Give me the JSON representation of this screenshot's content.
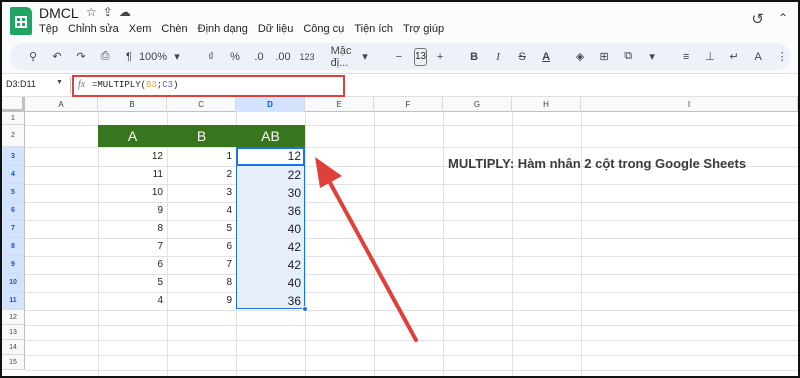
{
  "app": {
    "doc_title": "DMCL",
    "menu": [
      "Tệp",
      "Chỉnh sửa",
      "Xem",
      "Chèn",
      "Định dạng",
      "Dữ liệu",
      "Công cụ",
      "Tiện ích",
      "Trợ giúp"
    ]
  },
  "toolbar": {
    "zoom": "100%",
    "currency": "₫",
    "percent": "%",
    "decimal_decrease": ".0",
    "decimal_increase": ".00",
    "number_format": "123",
    "font": "Mặc đị...",
    "font_size": "13",
    "bold": "B",
    "italic": "I",
    "strike": "S",
    "text_color": "A"
  },
  "formula_bar": {
    "cell_ref": "D3:D11",
    "fx": "fx",
    "formula_prefix": "=MULTIPLY(",
    "ref1": "B3",
    "sep": ";",
    "ref2": "C3",
    "formula_suffix": ")"
  },
  "columns": [
    "A",
    "B",
    "C",
    "D",
    "E",
    "F",
    "G",
    "H",
    "I"
  ],
  "rows": [
    "1",
    "2",
    "3",
    "4",
    "5",
    "6",
    "7",
    "8",
    "9",
    "10",
    "11",
    "12",
    "13",
    "14",
    "15"
  ],
  "table": {
    "headers": [
      "A",
      "B",
      "AB"
    ],
    "rows": [
      {
        "b": "12",
        "c": "1",
        "d": "12"
      },
      {
        "b": "11",
        "c": "2",
        "d": "22"
      },
      {
        "b": "10",
        "c": "3",
        "d": "30"
      },
      {
        "b": "9",
        "c": "4",
        "d": "36"
      },
      {
        "b": "8",
        "c": "5",
        "d": "40"
      },
      {
        "b": "7",
        "c": "6",
        "d": "42"
      },
      {
        "b": "6",
        "c": "7",
        "d": "42"
      },
      {
        "b": "5",
        "c": "8",
        "d": "40"
      },
      {
        "b": "4",
        "c": "9",
        "d": "36"
      }
    ]
  },
  "annotation": "MULTIPLY: Hàm nhân 2 cột trong Google Sheets",
  "colors": {
    "header_green": "#38761d",
    "selection_blue": "#1a73e8",
    "highlight_red": "#e0403a"
  }
}
